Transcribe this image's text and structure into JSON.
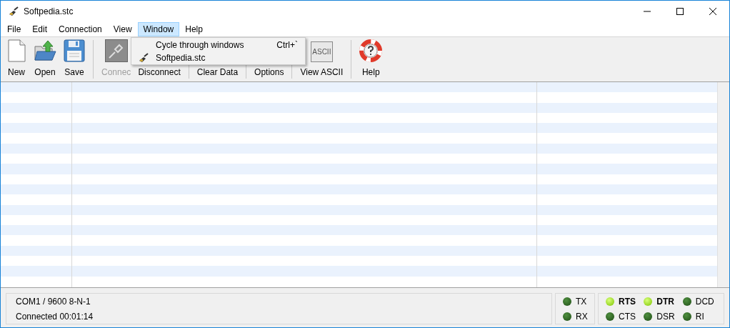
{
  "window": {
    "title": "Softpedia.stc"
  },
  "menu_bar": [
    {
      "label": "File",
      "selected": false
    },
    {
      "label": "Edit",
      "selected": false
    },
    {
      "label": "Connection",
      "selected": false
    },
    {
      "label": "View",
      "selected": false
    },
    {
      "label": "Window",
      "selected": true
    },
    {
      "label": "Help",
      "selected": false
    }
  ],
  "toolbar": [
    {
      "label": "New",
      "kind": "new",
      "disabled": false
    },
    {
      "label": "Open",
      "kind": "open",
      "disabled": false
    },
    {
      "label": "Save",
      "kind": "save",
      "disabled": false
    },
    {
      "kind": "separator"
    },
    {
      "label": "Connec",
      "kind": "connect",
      "disabled": true
    },
    {
      "label": "Disconnect",
      "kind": "hidden",
      "disabled": false
    },
    {
      "kind": "separator"
    },
    {
      "label": "Clear Data",
      "kind": "hidden",
      "disabled": false
    },
    {
      "kind": "separator"
    },
    {
      "label": "Options",
      "kind": "hidden",
      "disabled": false
    },
    {
      "kind": "separator"
    },
    {
      "label": "View ASCII",
      "kind": "ascii",
      "icon_text": "ASCII",
      "disabled": false
    },
    {
      "kind": "separator"
    },
    {
      "label": "Help",
      "kind": "help",
      "disabled": false
    }
  ],
  "window_menu": [
    {
      "label": "Cycle through windows",
      "shortcut": "Ctrl+`",
      "kind": "command"
    },
    {
      "label": "Softpedia.stc",
      "kind": "window"
    }
  ],
  "status_bar": {
    "port": "COM1 / 9600 8-N-1",
    "connection": "Connected 00:01:14",
    "traffic": [
      {
        "label": "TX",
        "on": false
      },
      {
        "label": "RX",
        "on": false
      }
    ],
    "signals": [
      {
        "label": "RTS",
        "on": true
      },
      {
        "label": "CTS",
        "on": false
      },
      {
        "label": "DTR",
        "on": true
      },
      {
        "label": "DSR",
        "on": false
      },
      {
        "label": "DCD",
        "on": false
      },
      {
        "label": "RI",
        "on": false
      }
    ]
  }
}
